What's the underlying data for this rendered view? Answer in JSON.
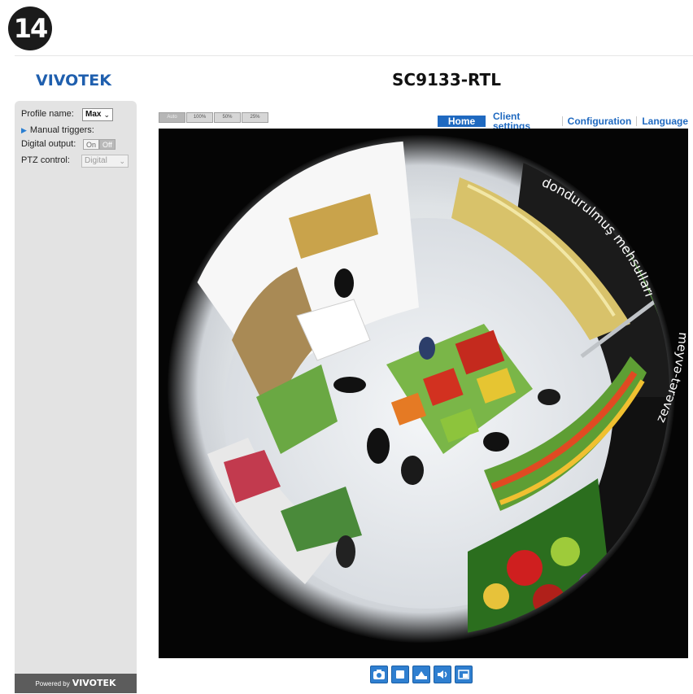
{
  "step_number": "14",
  "brand": {
    "logo_text": "VIVOTEK",
    "powered_prefix": "Powered by",
    "powered_brand": "VIVOTEK"
  },
  "header": {
    "model": "SC9133-RTL"
  },
  "sidebar": {
    "profile_label": "Profile name:",
    "profile_value": "Max",
    "manual_triggers_label": "Manual triggers:",
    "digital_output_label": "Digital output:",
    "digital_output_on": "On",
    "digital_output_off": "Off",
    "digital_output_state": "Off",
    "ptz_label": "PTZ control:",
    "ptz_value": "Digital"
  },
  "zoom_buttons": [
    "Auto",
    "100%",
    "50%",
    "25%"
  ],
  "zoom_selected": "Auto",
  "nav": {
    "home": "Home",
    "client_settings": "Client settings",
    "configuration": "Configuration",
    "language": "Language"
  },
  "video": {
    "sign_top": "dondurulmuş mehsulları",
    "sign_right": "meyvə-tərəvəz"
  },
  "icons": [
    "snapshot-icon",
    "stop-icon",
    "record-icon",
    "volume-icon",
    "view-size-icon"
  ],
  "colors": {
    "accent": "#1f69c0",
    "logo": "#1f5fae",
    "sidebar": "#e3e3e3",
    "footer": "#5c5c5c"
  }
}
